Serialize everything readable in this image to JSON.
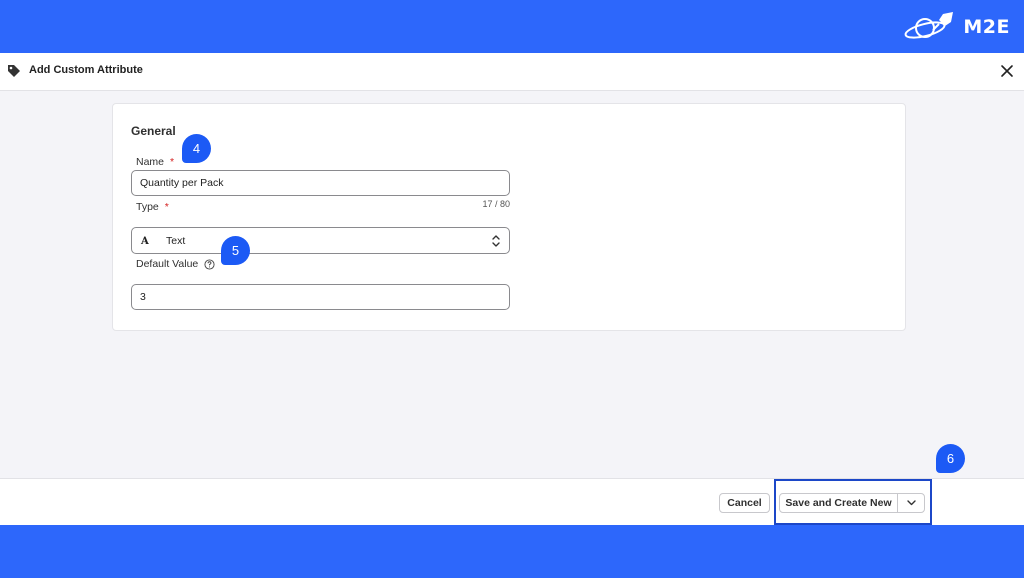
{
  "brand": {
    "logo_text": "M2E",
    "band_color": "#2d67fb",
    "badge_color": "#1c5af5"
  },
  "modal": {
    "title": "Add Custom Attribute",
    "header_icon": "tag-icon",
    "close_icon": "close-icon"
  },
  "form": {
    "section_title": "General",
    "name": {
      "label": "Name",
      "required_mark": "*",
      "value": "Quantity per Pack",
      "counter": "17 / 80"
    },
    "type": {
      "label": "Type",
      "required_mark": "*",
      "icon_glyph": "A",
      "selected": "Text"
    },
    "default_value": {
      "label": "Default Value",
      "value": "3",
      "help_icon": "question-circle-icon"
    }
  },
  "footer": {
    "cancel_label": "Cancel",
    "save_label": "Save and Create New",
    "dropdown_icon": "chevron-down-icon"
  },
  "callouts": {
    "name_step": "4",
    "default_value_step": "5",
    "save_step": "6"
  }
}
